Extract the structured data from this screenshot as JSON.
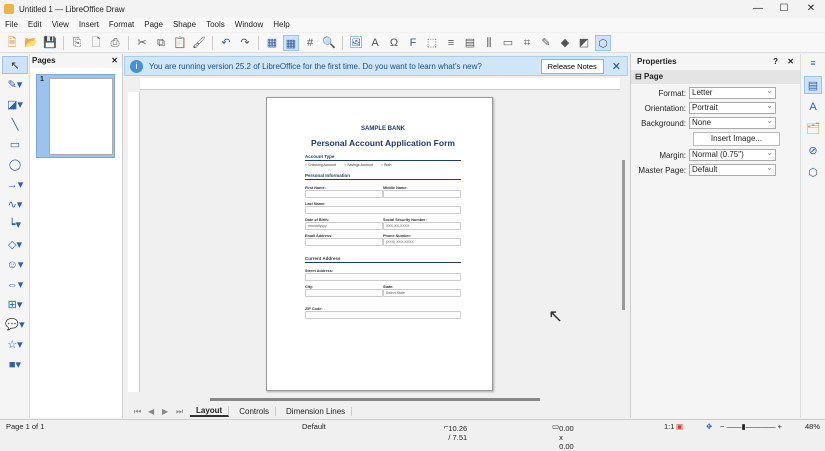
{
  "window": {
    "title": "Untitled 1 — LibreOffice Draw"
  },
  "menu": [
    "File",
    "Edit",
    "View",
    "Insert",
    "Format",
    "Page",
    "Shape",
    "Tools",
    "Window",
    "Help"
  ],
  "pages_panel": {
    "title": "Pages",
    "page_number": "1"
  },
  "infobar": {
    "message": "You are running version 25.2 of LibreOffice for the first time. Do you want to learn what's new?",
    "button": "Release Notes"
  },
  "document": {
    "bank": "SAMPLE BANK",
    "title": "Personal Account Application Form",
    "account_type": {
      "heading": "Account Type",
      "options": [
        "Checking Account",
        "Savings Account",
        "Both"
      ]
    },
    "personal": {
      "heading": "Personal Information",
      "first": "First Name:",
      "middle": "Middle Name:",
      "last": "Last Name:",
      "dob": "Date of Birth:",
      "dob_ph": "mm/dd/yyyy",
      "ssn": "Social Security Number:",
      "ssn_ph": "XXX-XX-XXXX",
      "email": "Email Address:",
      "phone": "Phone Number:",
      "phone_ph": "(XXX) XXX-XXXX"
    },
    "address": {
      "heading": "Current Address",
      "street": "Street Address:",
      "city": "City:",
      "state": "State:",
      "state_value": "Select State",
      "zip": "ZIP Code:"
    }
  },
  "tabs": [
    {
      "label": "Layout",
      "active": true
    },
    {
      "label": "Controls"
    },
    {
      "label": "Dimension Lines"
    }
  ],
  "properties": {
    "title": "Properties",
    "section": "Page",
    "format_label": "Format:",
    "format": "Letter",
    "orientation_label": "Orientation:",
    "orientation": "Portrait",
    "background_label": "Background:",
    "background": "None",
    "insert_image": "Insert Image...",
    "margin_label": "Margin:",
    "margin": "Normal (0.75\")",
    "master_label": "Master Page:",
    "master": "Default"
  },
  "status": {
    "page": "Page 1 of 1",
    "master": "Default",
    "position": "10.26 / 7.51",
    "size": "0.00 x 0.00",
    "scale": "1:1",
    "zoom": "48%"
  }
}
